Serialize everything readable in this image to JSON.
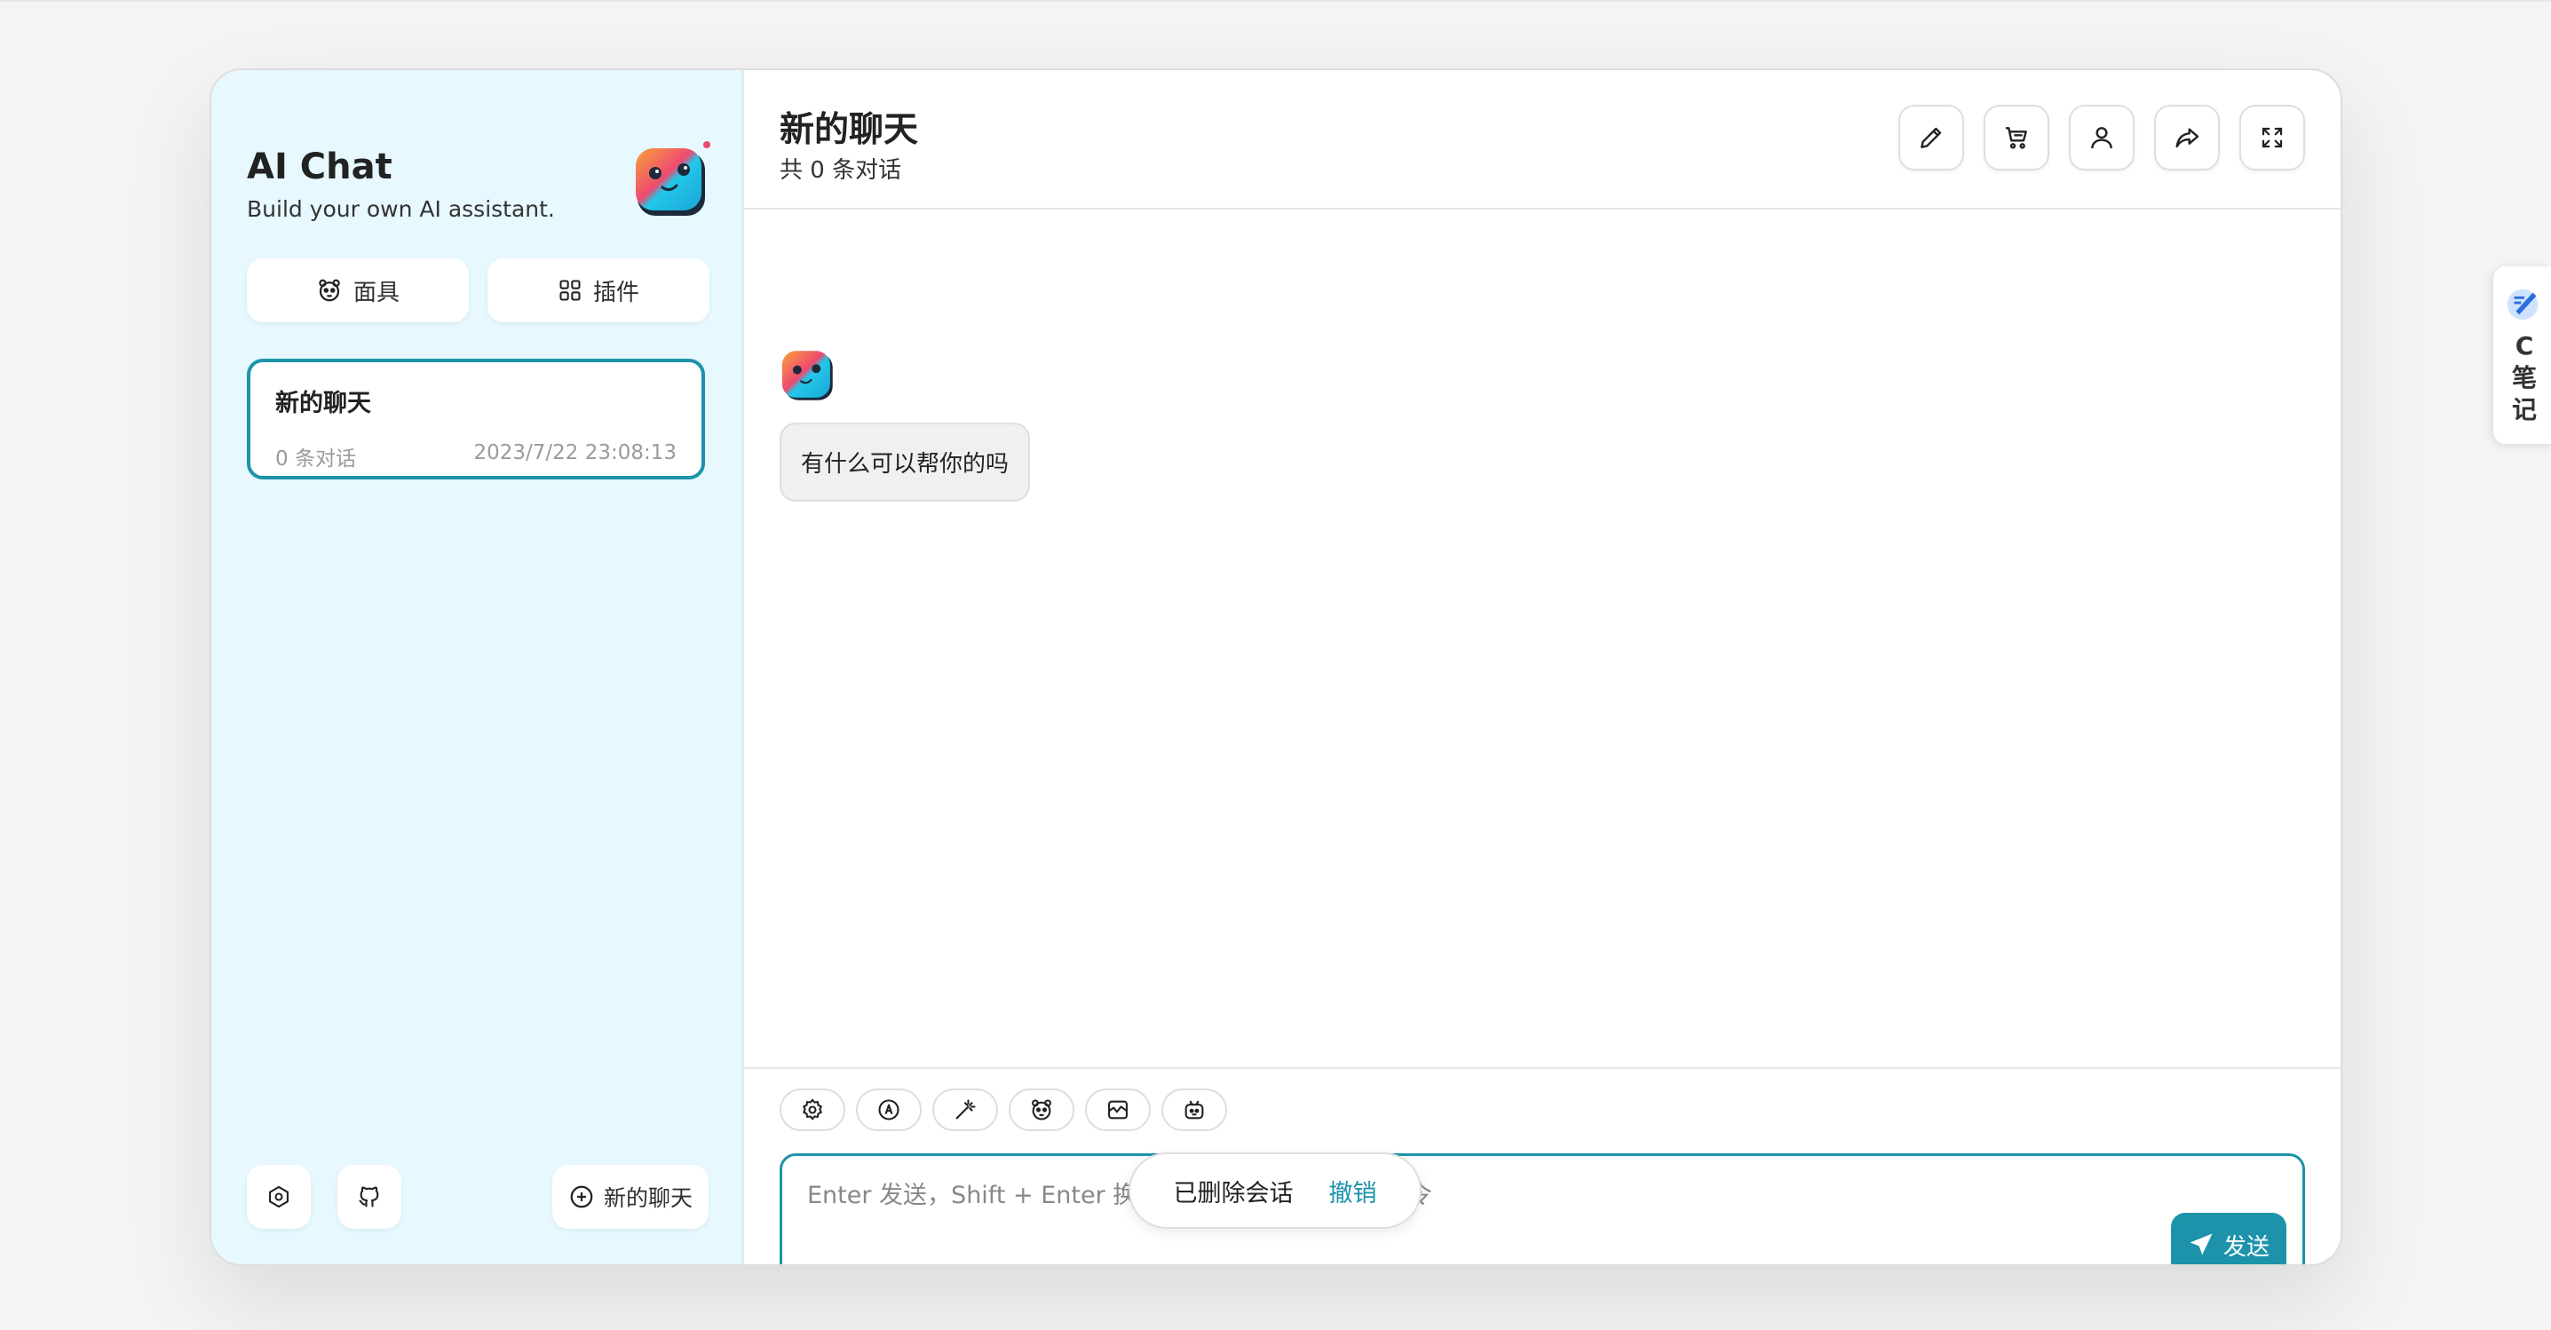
{
  "brand": {
    "title": "AI Chat",
    "subtitle": "Build your own AI assistant."
  },
  "sidebar": {
    "mask_label": "面具",
    "plugin_label": "插件",
    "chats": [
      {
        "title": "新的聊天",
        "count": "0 条对话",
        "time": "2023/7/22 23:08:13"
      }
    ],
    "new_chat_label": "新的聊天"
  },
  "header": {
    "title": "新的聊天",
    "subtitle": "共 0 条对话"
  },
  "messages": [
    {
      "role": "bot",
      "text": "有什么可以帮你的吗"
    }
  ],
  "input": {
    "placeholder": "Enter 发送，Shift + Enter 换行，/ 触发补全，: 触发命令",
    "send_label": "发送"
  },
  "toast": {
    "text": "已删除会话",
    "action": "撤销"
  },
  "side_tab": {
    "label": "C笔记"
  },
  "colors": {
    "accent": "#1d93ab",
    "sidebar_bg": "#e7f8ff"
  }
}
